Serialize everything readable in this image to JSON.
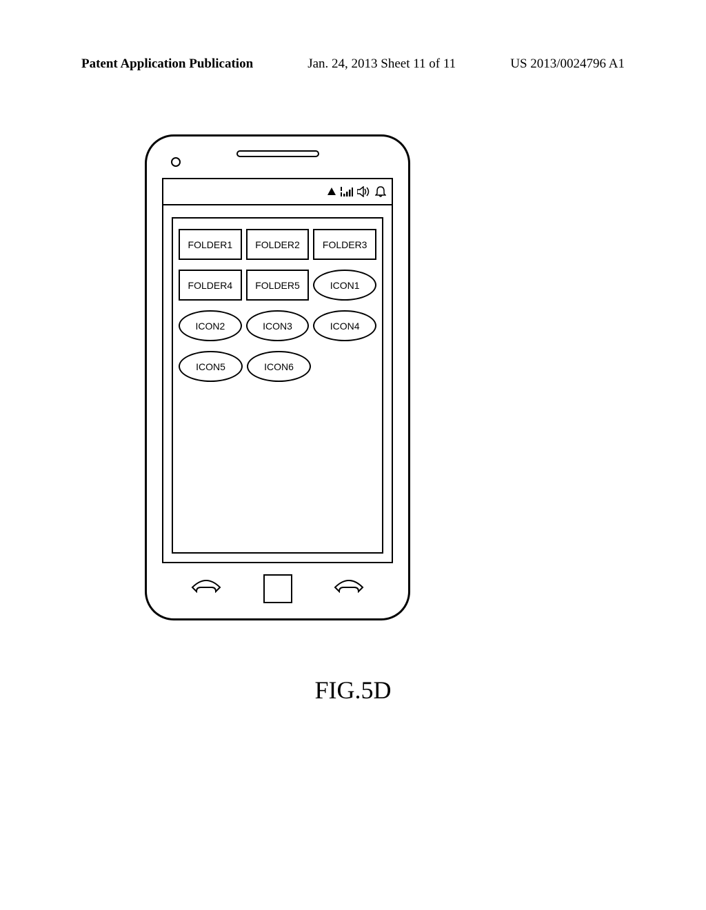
{
  "header": {
    "left": "Patent Application Publication",
    "center": "Jan. 24, 2013  Sheet 11 of 11",
    "right": "US 2013/0024796 A1"
  },
  "grid": {
    "row1": {
      "c1": "FOLDER1",
      "c2": "FOLDER2",
      "c3": "FOLDER3"
    },
    "row2": {
      "c1": "FOLDER4",
      "c2": "FOLDER5",
      "c3": "ICON1"
    },
    "row3": {
      "c1": "ICON2",
      "c2": "ICON3",
      "c3": "ICON4"
    },
    "row4": {
      "c1": "ICON5",
      "c2": "ICON6"
    }
  },
  "figure_label": "FIG.5D"
}
